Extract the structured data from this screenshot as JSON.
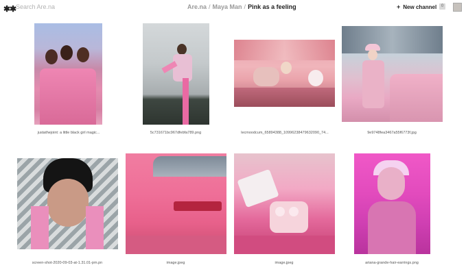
{
  "header": {
    "logo": "✱✱",
    "search_placeholder": "Search Are.na",
    "breadcrumb": {
      "root": "Are.na",
      "owner": "Maya Man",
      "channel": "Pink as a feeling",
      "separator": "/"
    },
    "new_channel_label": "New channel",
    "notification_count": "0"
  },
  "blocks": [
    {
      "caption": "justathejoint: a little black girl magic..."
    },
    {
      "caption": "5c731671bc967dfebfa789.png"
    },
    {
      "caption": "lecmoodcum_65894388_10996238479632090_74..."
    },
    {
      "caption": "9e9748fea3467a55f6773f.jpg"
    },
    {
      "caption": "screen-shot-2020-09-03-at-1.31.01-pm.pn"
    },
    {
      "caption": "image.jpeg"
    },
    {
      "caption": "image.jpeg"
    },
    {
      "caption": "ariana-grande-hair-earrings.png"
    }
  ]
}
